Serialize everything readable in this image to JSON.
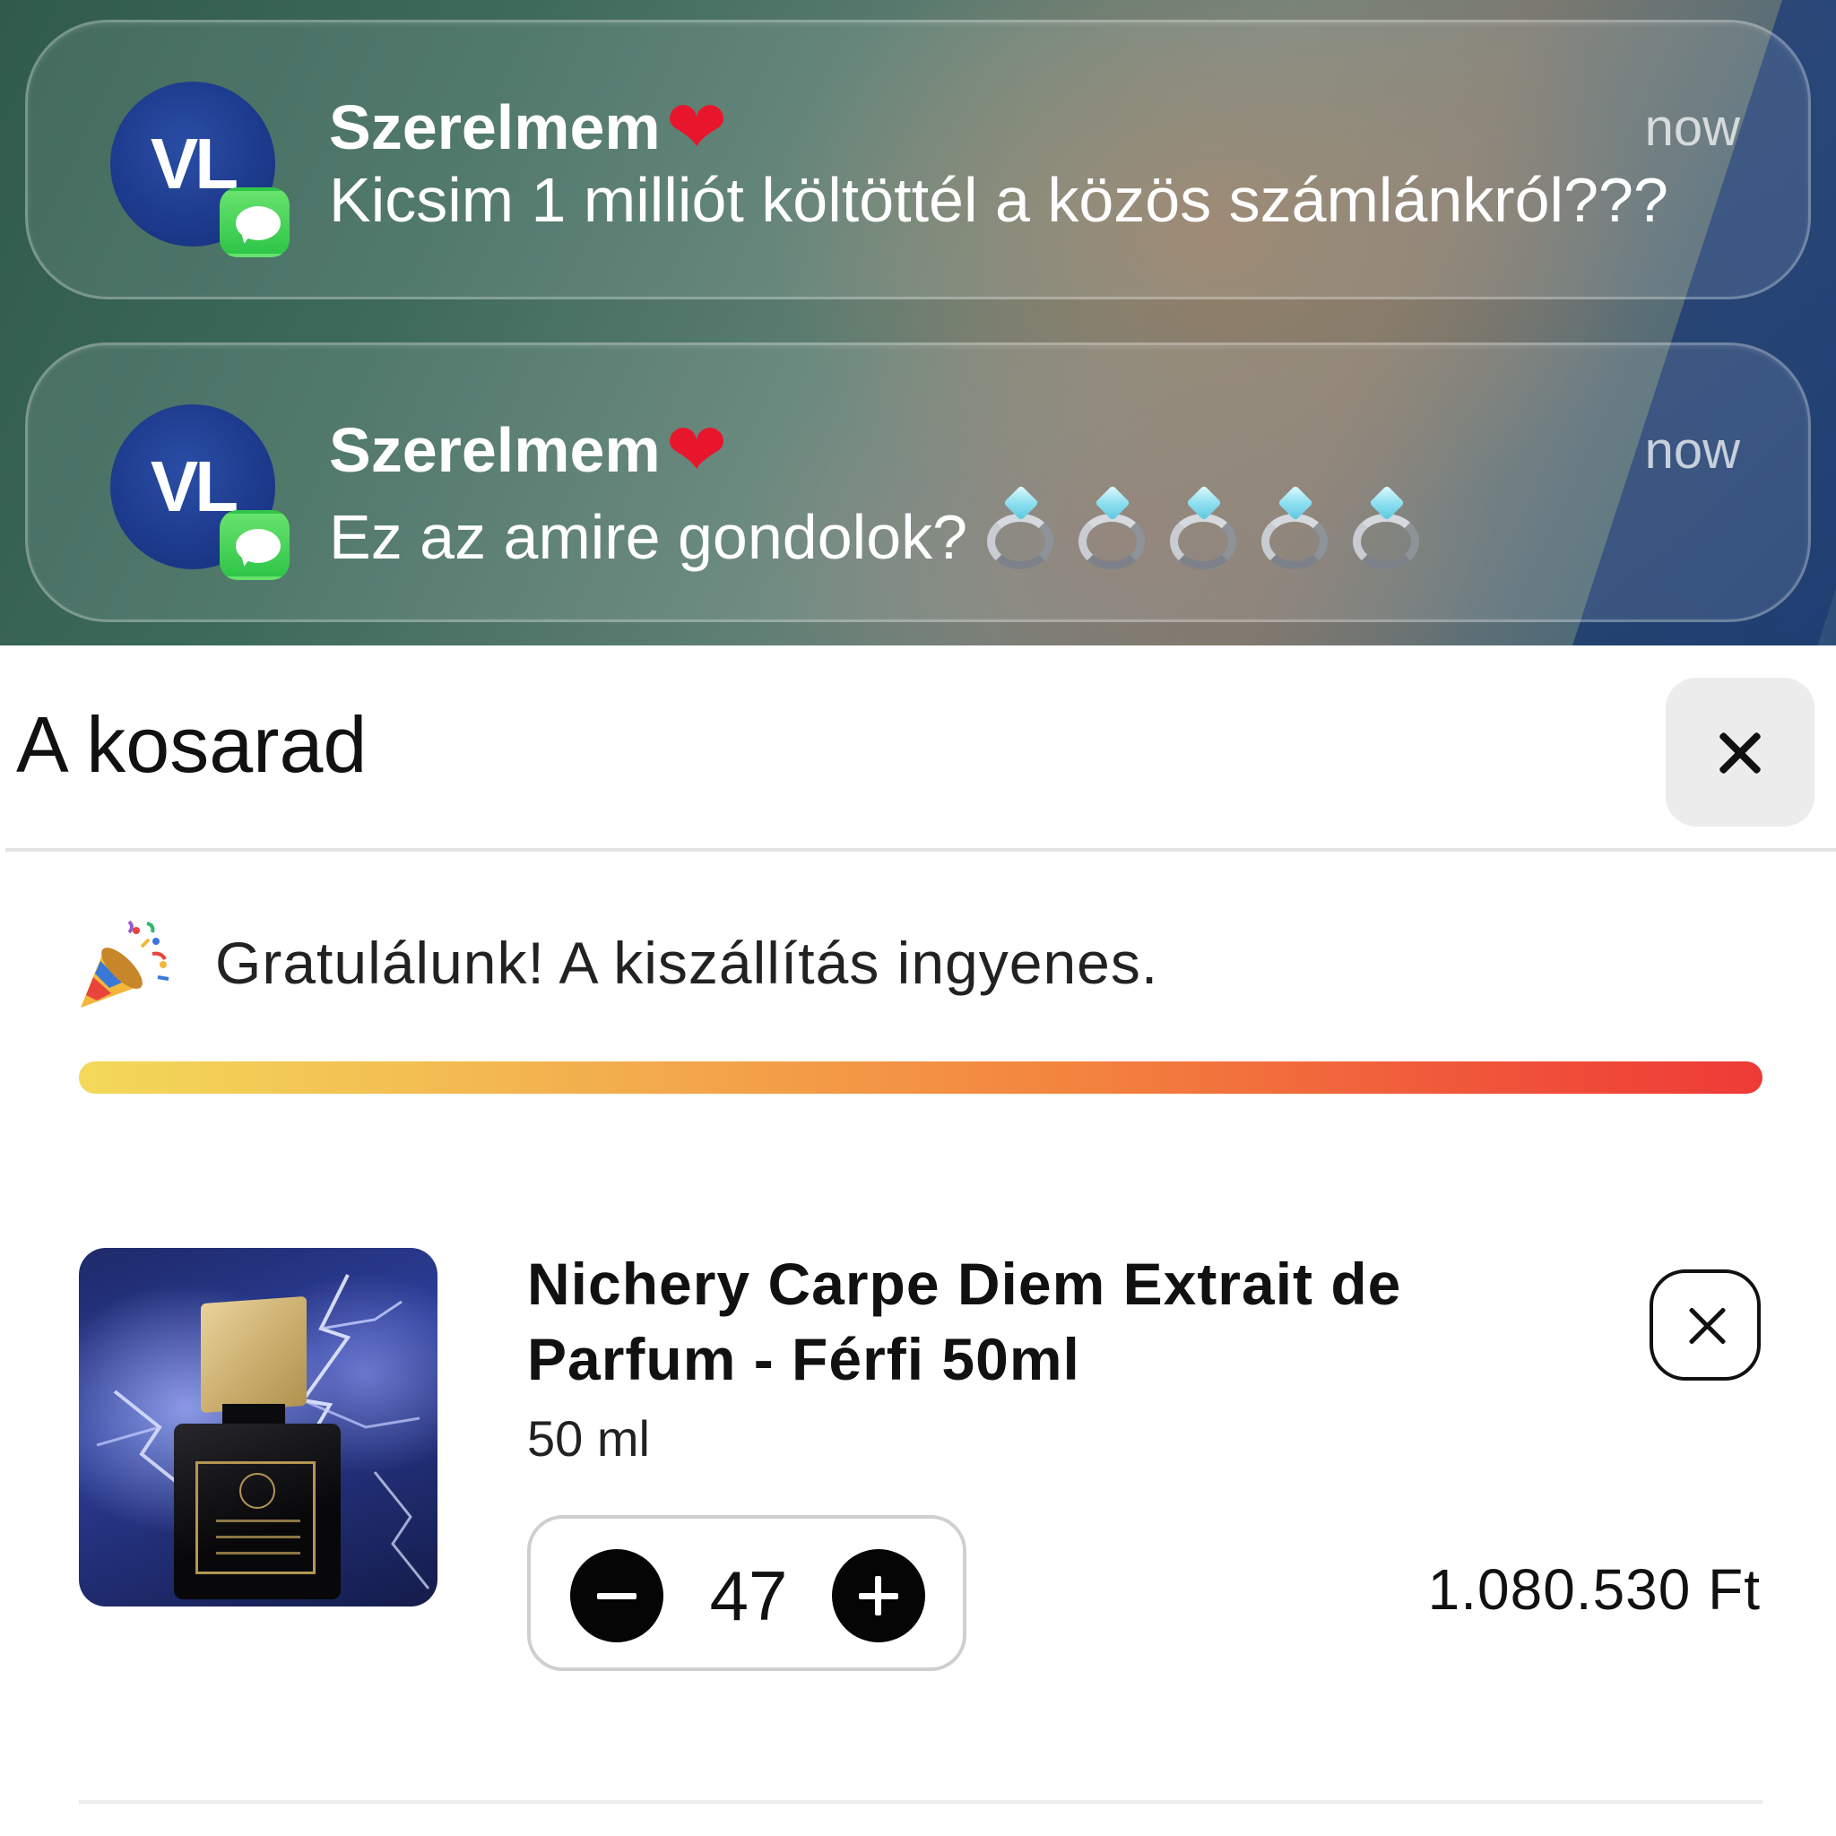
{
  "notifications": [
    {
      "avatar_initials": "VL",
      "sender": "Szerelmem",
      "sender_emoji": "❤",
      "time": "now",
      "message": "Kicsim 1 milliót költöttél a közös számlánkról???",
      "app_icon": "messages-icon"
    },
    {
      "avatar_initials": "VL",
      "sender": "Szerelmem",
      "sender_emoji": "❤",
      "time": "now",
      "message": "Ez az amire gondolok?",
      "trailing_emoji": "ring-emoji",
      "trailing_emoji_count": 5,
      "app_icon": "messages-icon"
    }
  ],
  "cart": {
    "title": "A kosarad",
    "close_icon": "close-icon",
    "shipping": {
      "icon": "party-popper-icon",
      "message": "Gratulálunk! A kiszállítás ingyenes.",
      "progress": 1.0
    },
    "items": [
      {
        "name": "Nichery Carpe Diem Extrait de Parfum - Férfi 50ml",
        "variant": "50 ml",
        "quantity": "47",
        "price": "1.080.530 Ft",
        "image": "perfume-bottle-lightning"
      }
    ]
  },
  "colors": {
    "accent_dark": "#050505",
    "avatar_blue": "#1a3687",
    "messages_green": "#34c759",
    "progress_start": "#f3d95a",
    "progress_end": "#ee3a36"
  }
}
